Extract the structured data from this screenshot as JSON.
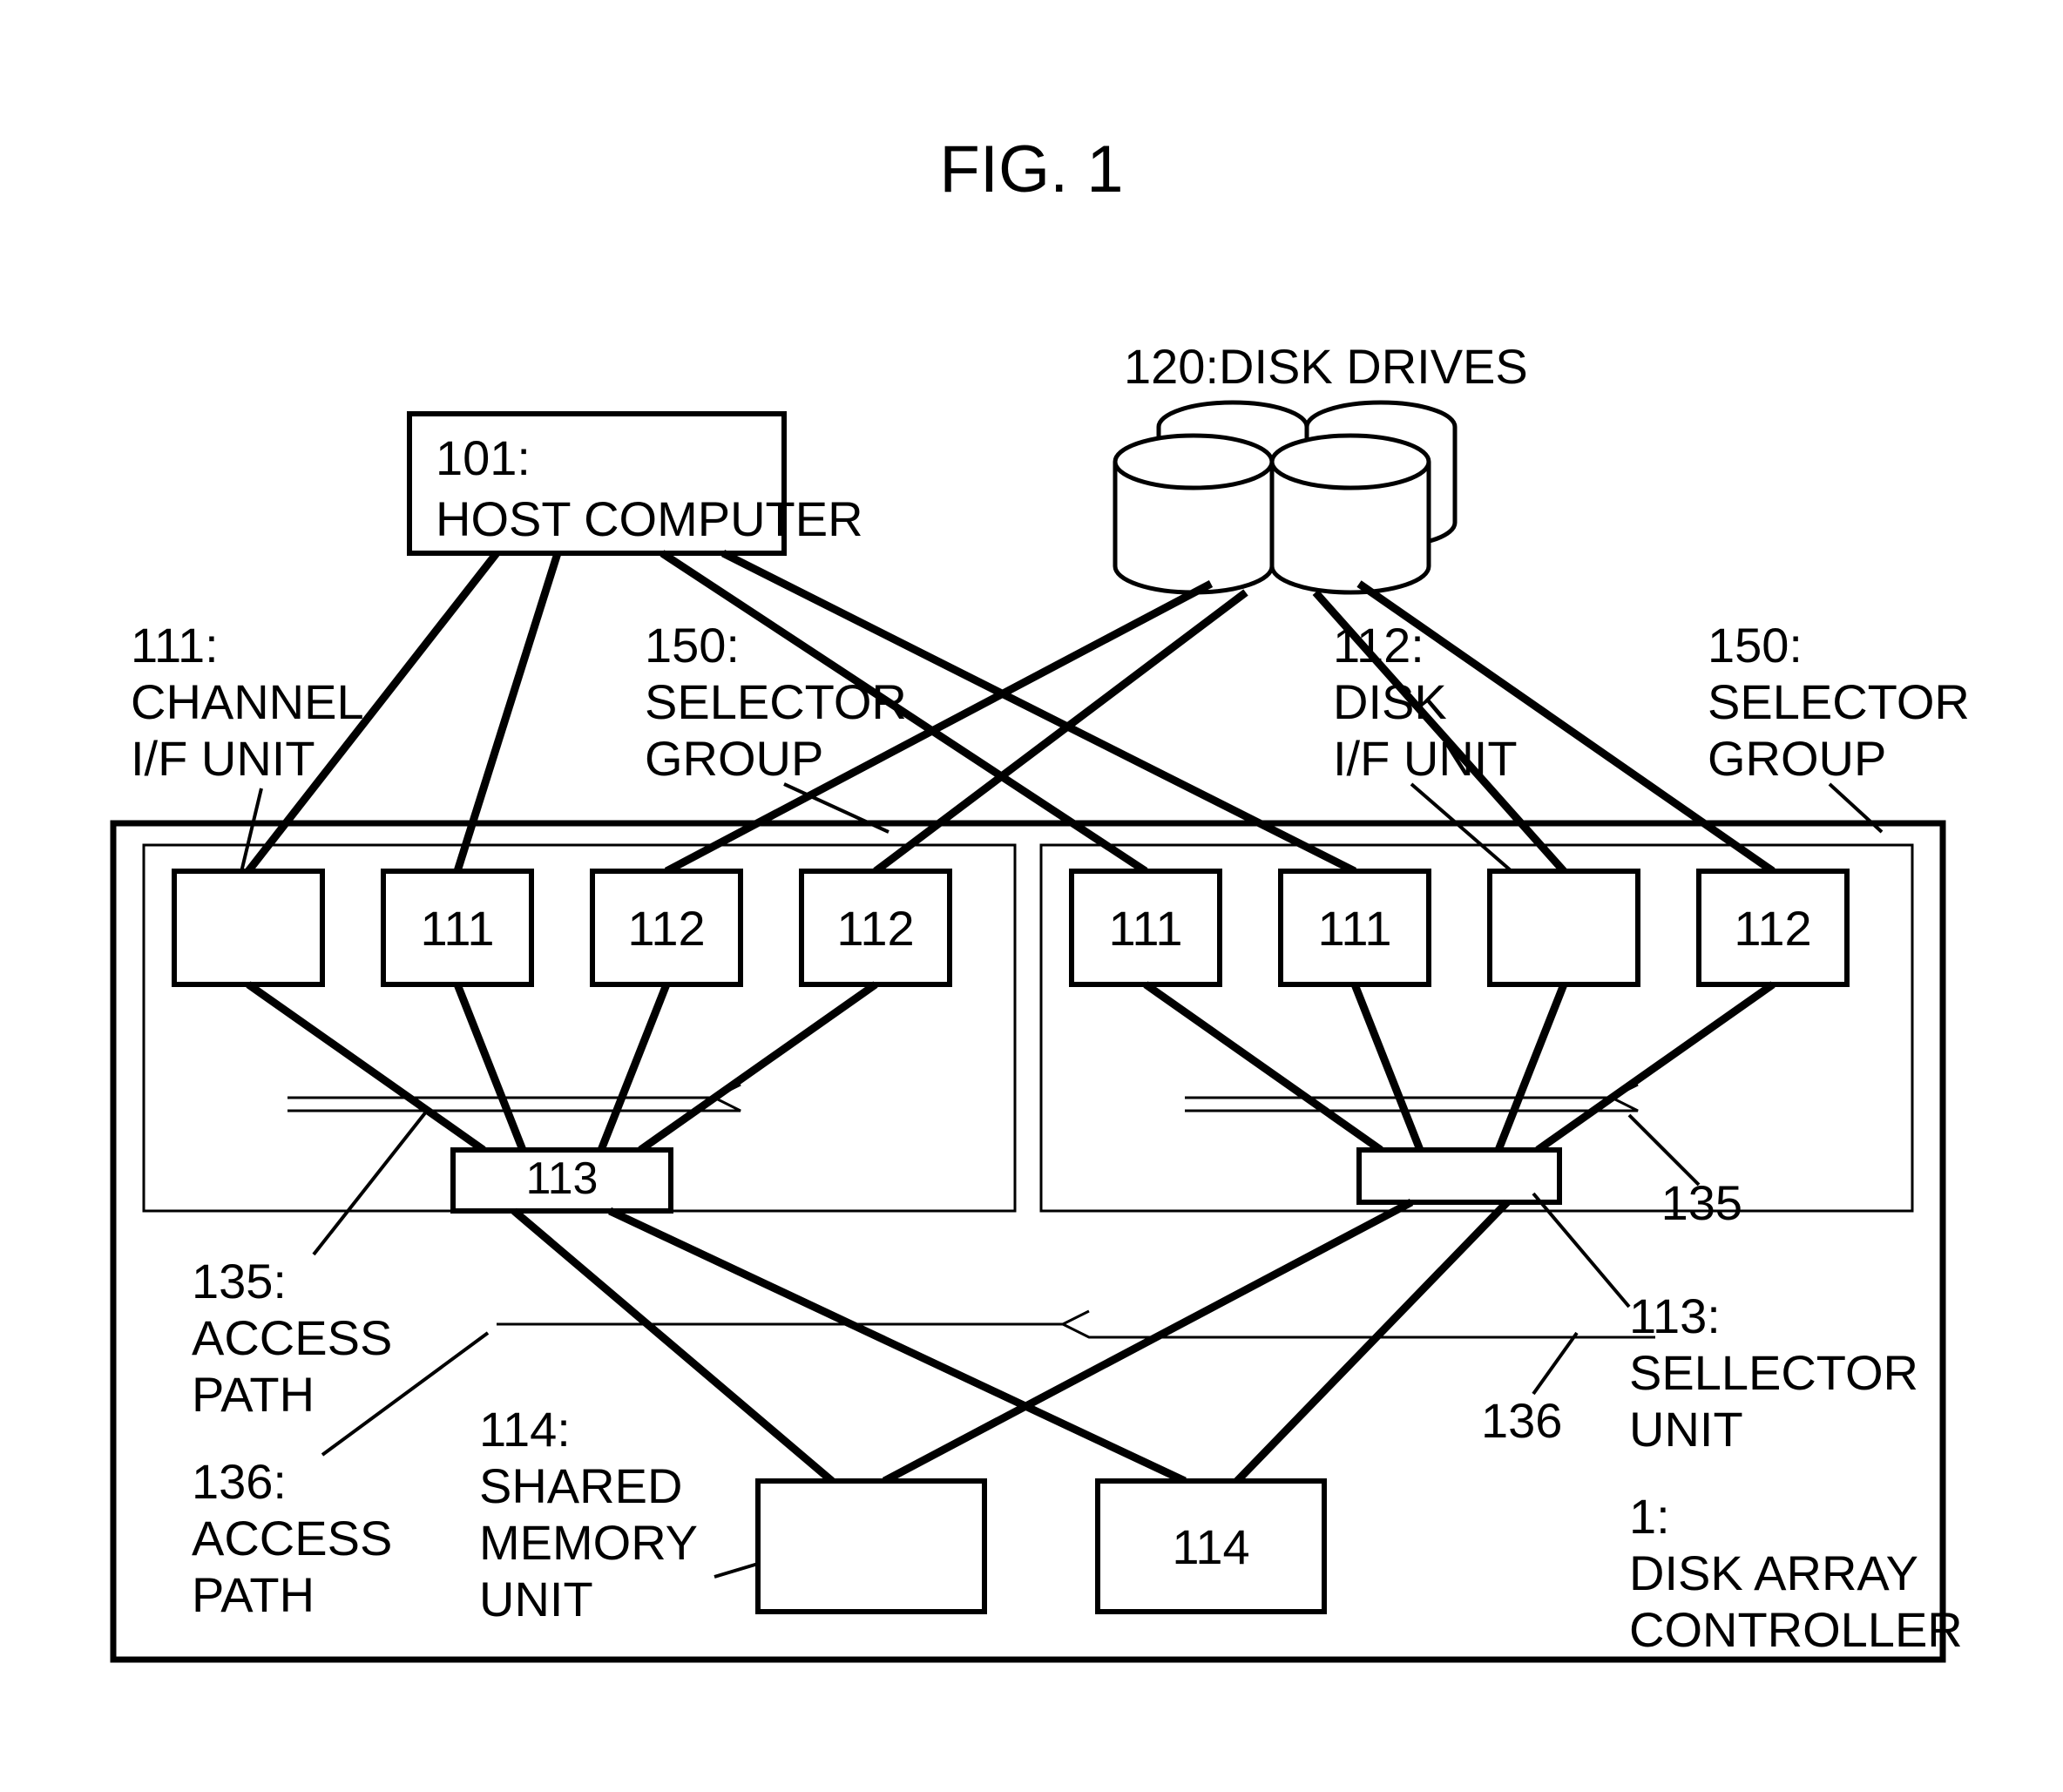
{
  "figure_title": "FIG. 1",
  "labels": {
    "disk_drives": {
      "ref": "120",
      "text": "DISK DRIVES"
    },
    "host_computer": {
      "ref": "101:",
      "text": "HOST COMPUTER"
    },
    "channel_if": {
      "ref": "111:",
      "text1": "CHANNEL",
      "text2": "I/F UNIT"
    },
    "selector_group_l": {
      "ref": "150:",
      "text1": "SELECTOR",
      "text2": "GROUP"
    },
    "disk_if": {
      "ref": "112:",
      "text1": "DISK",
      "text2": "I/F UNIT"
    },
    "selector_group_r": {
      "ref": "150:",
      "text1": "SELECTOR",
      "text2": "GROUP"
    },
    "access_path_135": {
      "ref": "135:",
      "text1": "ACCESS",
      "text2": "PATH"
    },
    "access_path_135_r": "135",
    "selector_unit": {
      "ref": "113:",
      "text1": "SELLECTOR",
      "text2": "UNIT"
    },
    "access_path_136": {
      "ref": "136:",
      "text1": "ACCESS",
      "text2": "PATH"
    },
    "access_path_136_bare": "136",
    "shared_memory": {
      "ref": "114:",
      "text1": "SHARED",
      "text2": "MEMORY",
      "text3": "UNIT"
    },
    "disk_array_ctrl": {
      "ref": "1:",
      "text1": "DISK ARRAY",
      "text2": "CONTROLLER"
    }
  },
  "boxes": {
    "left": [
      "",
      "111",
      "112",
      "112"
    ],
    "right": [
      "111",
      "111",
      "",
      "112"
    ],
    "sel_left": "113",
    "sel_right": "",
    "mem_left": "",
    "mem_right": "114"
  }
}
